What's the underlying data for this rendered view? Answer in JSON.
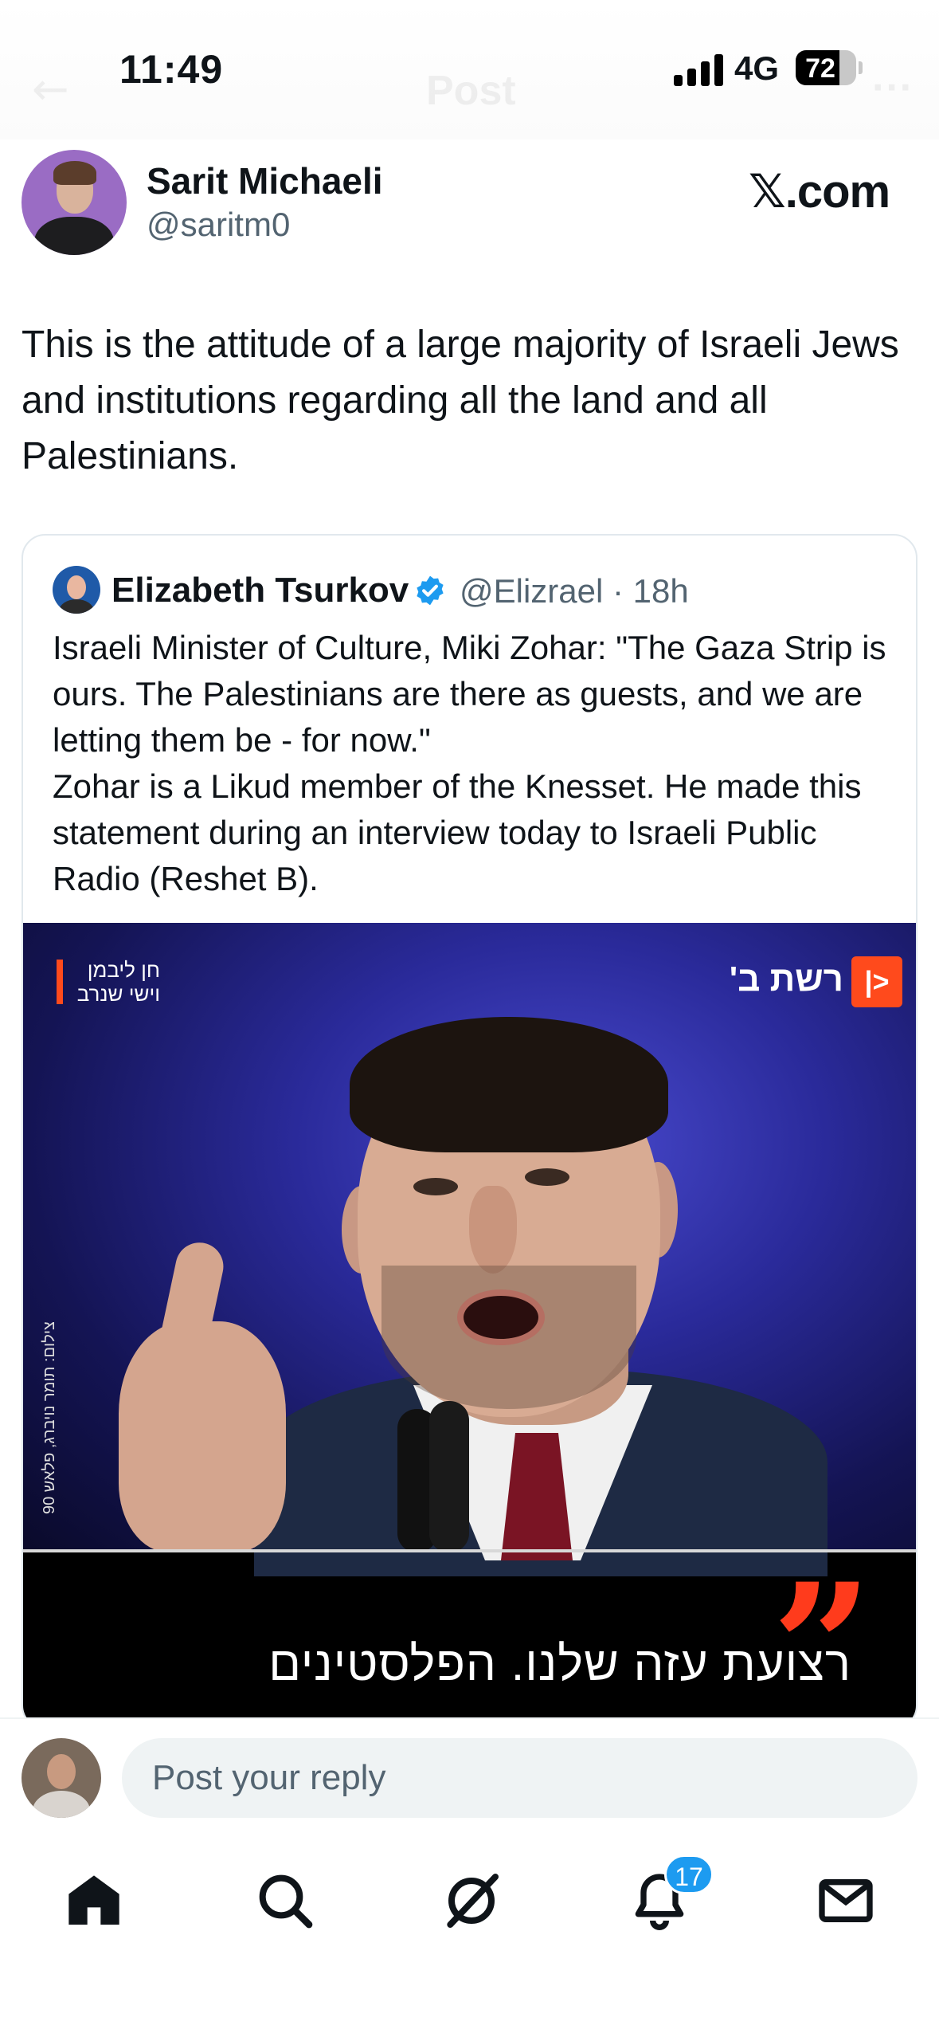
{
  "status_bar": {
    "time": "11:49",
    "network": "4G",
    "battery_level": "72",
    "battery_fraction": 0.72
  },
  "header": {
    "title": "Post"
  },
  "author": {
    "name": "Sarit Michaeli",
    "handle": "@saritm0"
  },
  "brand": "𝕏.com",
  "tweet": {
    "text": "This is the attitude of a large majority of Israeli Jews and institutions regarding all the land and all Palestinians."
  },
  "quote": {
    "name": "Elizabeth Tsurkov",
    "handle": "@Elizrael · 18h",
    "text": "Israeli Minister of Culture, Miki Zohar: \"The Gaza Strip is ours. The Palestinians are there as guests, and we are letting them be - for now.\"\nZohar is a Likud member of the Knesset. He made this statement during an interview today to Israeli Public Radio (Reshet B).",
    "media": {
      "credit": "חן ליבמן\nוישי שנרב",
      "logo_text": "רשת ב'",
      "logo_mark": "|>",
      "photo_credit": "צילום: תומר נויברג, פלאש 90",
      "caption": "רצועת עזה שלנו. הפלסטינים"
    }
  },
  "reply": {
    "placeholder": "Post your reply"
  },
  "nav": {
    "notifications_count": "17"
  }
}
